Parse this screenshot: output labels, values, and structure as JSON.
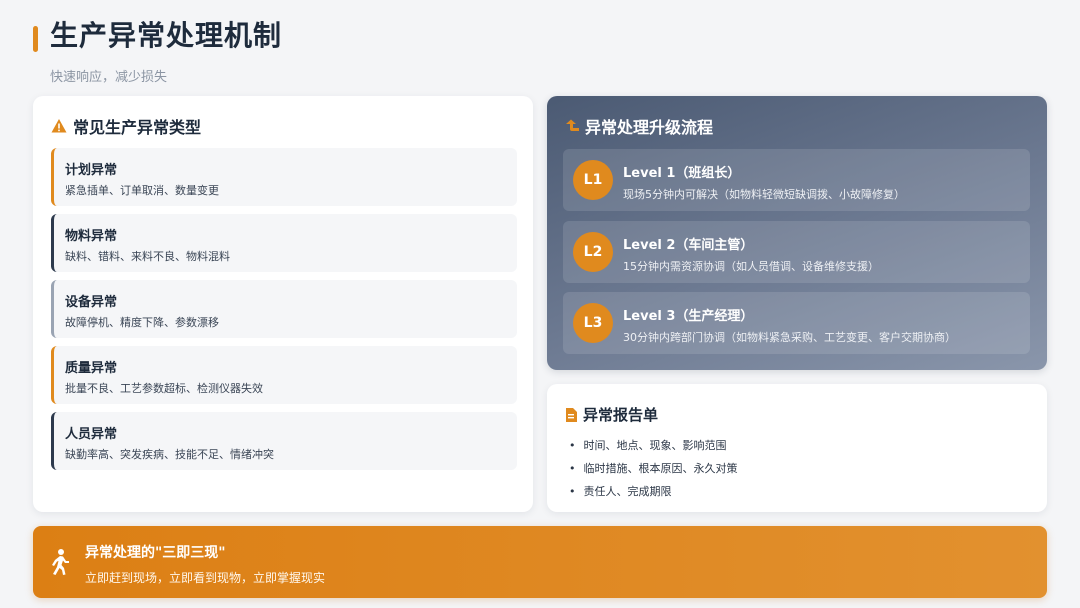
{
  "header": {
    "title": "生产异常处理机制",
    "subtitle": "快速响应，减少损失"
  },
  "types_card": {
    "title": "常见生产异常类型",
    "icon": "warning-icon",
    "items": [
      {
        "name": "计划异常",
        "desc": "紧急插单、订单取消、数量变更",
        "border_color": "#e08a1e"
      },
      {
        "name": "物料异常",
        "desc": "缺料、错料、来料不良、物料混料",
        "border_color": "#2d3a4d"
      },
      {
        "name": "设备异常",
        "desc": "故障停机、精度下降、参数漂移",
        "border_color": "#9aa4b3"
      },
      {
        "name": "质量异常",
        "desc": "批量不良、工艺参数超标、检测仪器失效",
        "border_color": "#e08a1e"
      },
      {
        "name": "人员异常",
        "desc": "缺勤率高、突发疾病、技能不足、情绪冲突",
        "border_color": "#2d3a4d"
      }
    ]
  },
  "flow_card": {
    "title": "异常处理升级流程",
    "icon": "arrow-up-right-icon",
    "levels": [
      {
        "badge": "L1",
        "name": "Level 1（班组长）",
        "desc": "现场5分钟内可解决（如物料轻微短缺调拨、小故障修复）"
      },
      {
        "badge": "L2",
        "name": "Level 2（车间主管）",
        "desc": "15分钟内需资源协调（如人员借调、设备维修支援）"
      },
      {
        "badge": "L3",
        "name": "Level 3（生产经理）",
        "desc": "30分钟内跨部门协调（如物料紧急采购、工艺变更、客户交期协商）"
      }
    ]
  },
  "report_card": {
    "title": "异常报告单",
    "icon": "document-icon",
    "items": [
      "时间、地点、现象、影响范围",
      "临时措施、根本原因、永久对策",
      "责任人、完成期限"
    ]
  },
  "banner": {
    "icon": "running-person-icon",
    "title": "异常处理的\"三即三现\"",
    "desc": "立即赶到现场，立即看到现物，立即掌握现实"
  },
  "colors": {
    "accent": "#e08a1e",
    "dark": "#1e2b3c",
    "flow_bg": "#5c6a82"
  }
}
